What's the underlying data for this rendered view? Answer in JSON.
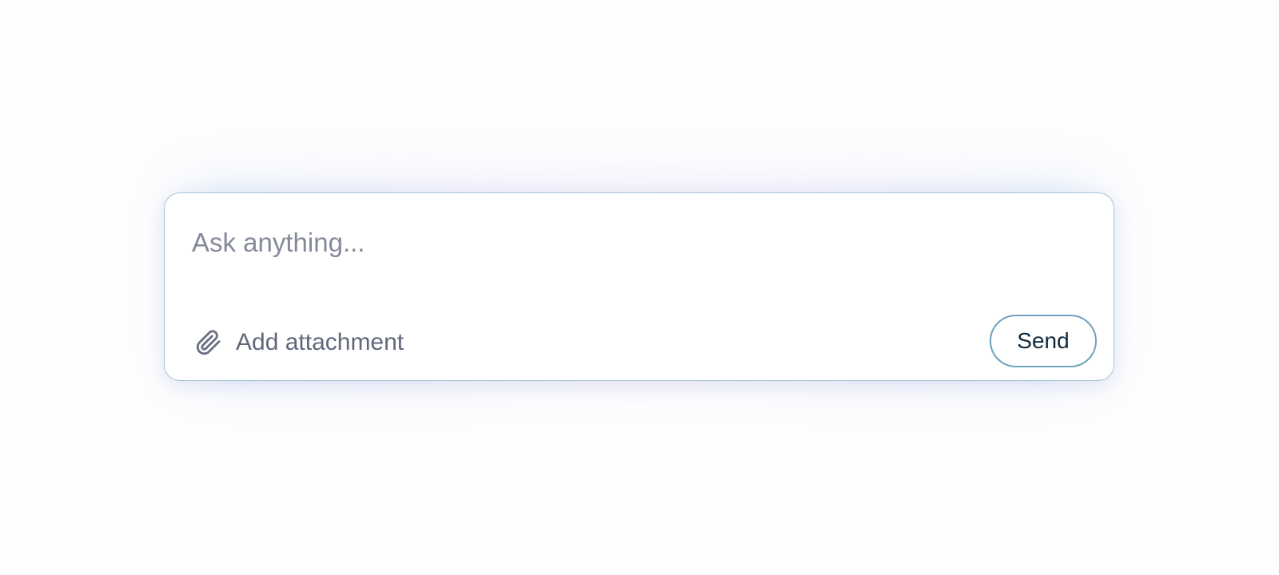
{
  "composer": {
    "input": {
      "value": "",
      "placeholder": "Ask anything..."
    },
    "attachment": {
      "icon": "paperclip-icon",
      "label": "Add attachment"
    },
    "send_label": "Send"
  },
  "colors": {
    "page_background": "#fdfdfe",
    "composer_border": "#a9c2d6",
    "placeholder_text": "#858a99",
    "attachment_text": "#60687a",
    "send_border": "#6fa2bd",
    "send_text": "#0f2a3c"
  }
}
